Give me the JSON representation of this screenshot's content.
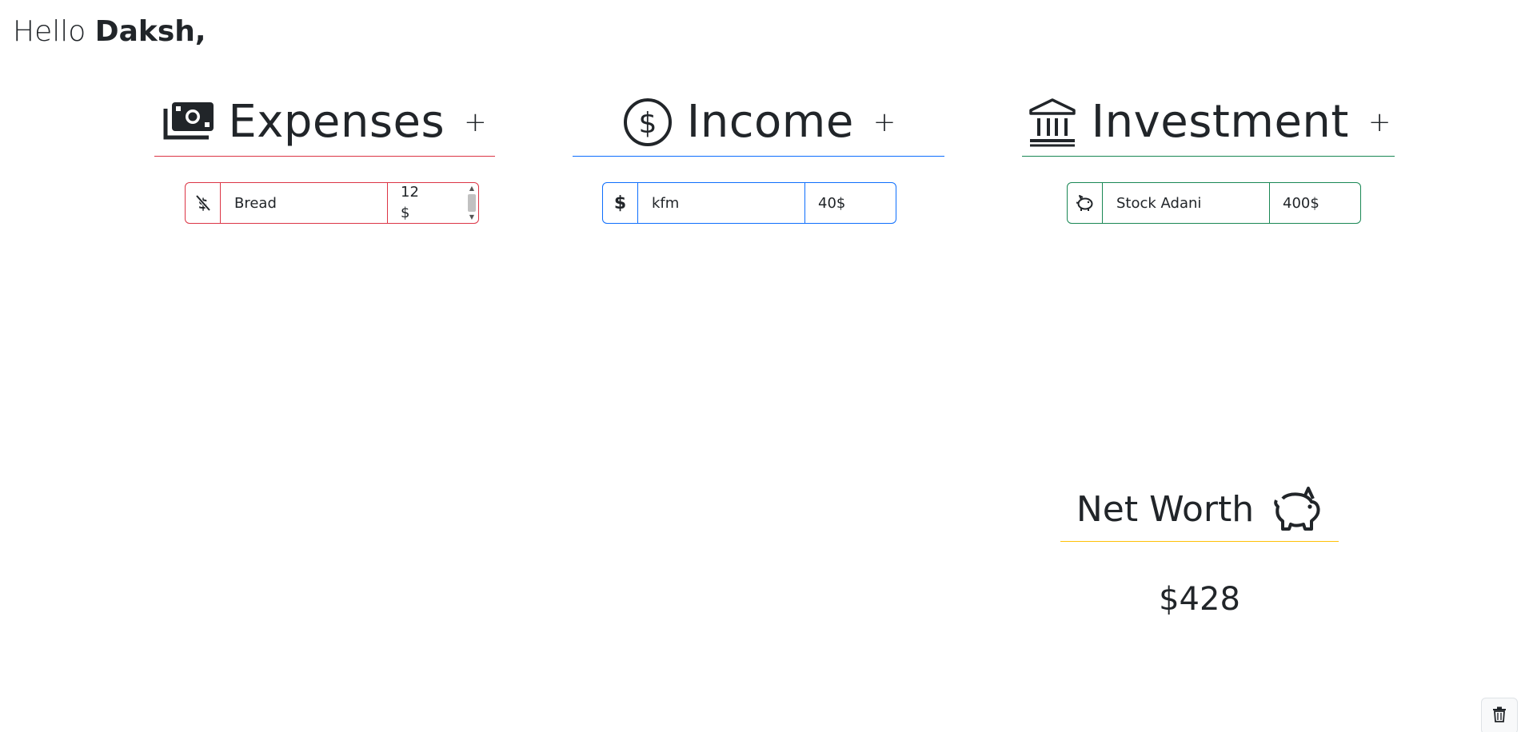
{
  "greeting": {
    "hello": "Hello",
    "name": "Daksh,"
  },
  "sections": {
    "expenses": {
      "title": "Expenses",
      "add": "+",
      "icon": "money-bill-icon",
      "color": "#dc3545"
    },
    "income": {
      "title": "Income",
      "add": "+",
      "icon": "dollar-coin-icon",
      "color": "#0d6efd"
    },
    "investment": {
      "title": "Investment",
      "add": "+",
      "icon": "bank-icon",
      "color": "#198754"
    }
  },
  "rows": {
    "expense": {
      "icon": "no-dollar-icon",
      "name": "Bread",
      "amount_line1": "12",
      "amount_line2": "$"
    },
    "income": {
      "icon_text": "$",
      "name": "kfm",
      "amount": "40$"
    },
    "investment": {
      "icon": "piggy-bank-icon",
      "name": "Stock Adani",
      "amount": "400$"
    }
  },
  "net_worth": {
    "title": "Net Worth",
    "icon": "piggy-bank-icon",
    "value": "$428",
    "color": "#ffc107"
  },
  "actions": {
    "delete_icon": "trash-icon"
  }
}
